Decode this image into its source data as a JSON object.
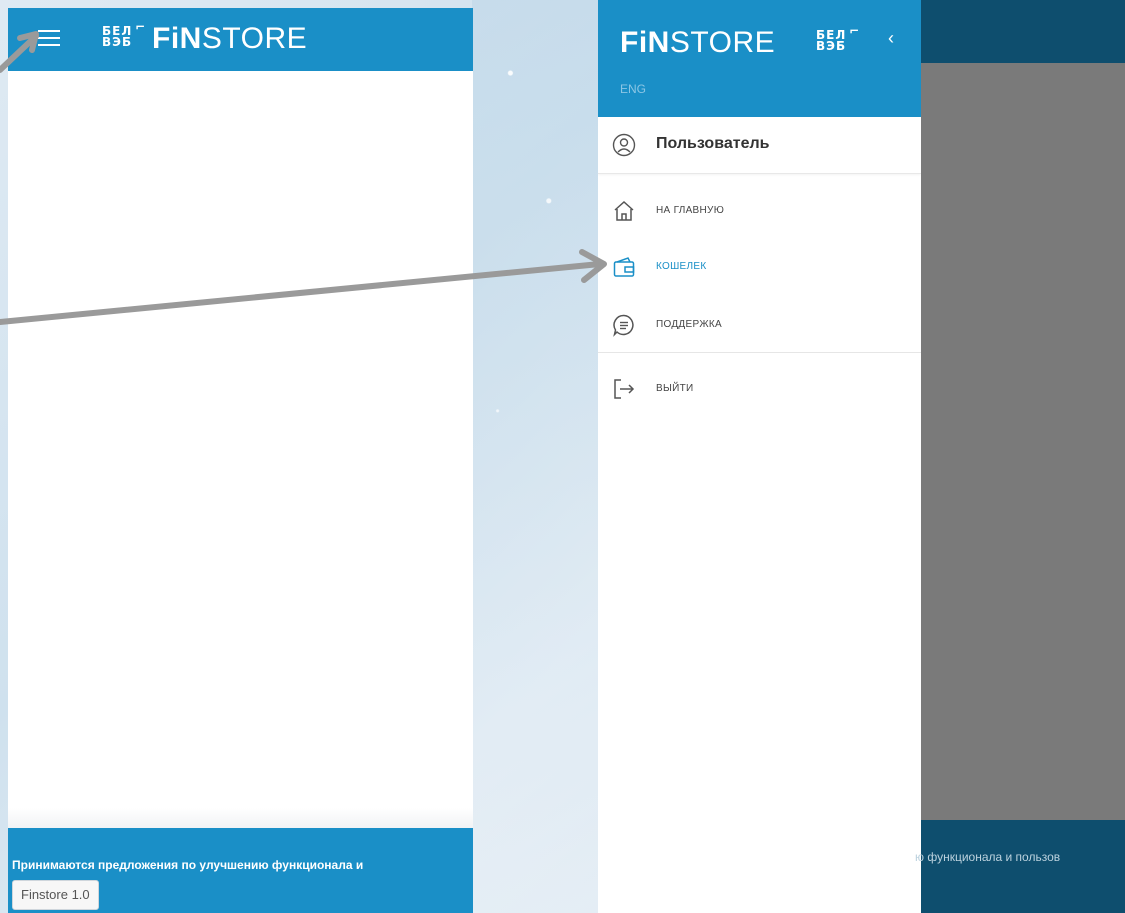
{
  "brand": {
    "bel_top": "БЕЛ",
    "bel_bottom": "ВЭБ",
    "fin_bold": "FiN",
    "fin_light": "STORE"
  },
  "left_screen": {
    "footer_text": "Принимаются предложения по улучшению функционала и",
    "version_label": "Finstore 1.0"
  },
  "drawer": {
    "back_icon": "chevron-left-icon",
    "lang_label": "ENG",
    "user_label": "Пользователь",
    "menu": [
      {
        "label": "НА ГЛАВНУЮ",
        "icon": "home-icon",
        "active": false
      },
      {
        "label": "КОШЕЛЕК",
        "icon": "wallet-icon",
        "active": true
      },
      {
        "label": "ПОДДЕРЖКА",
        "icon": "chat-icon",
        "active": false
      },
      {
        "label": "ВЫЙТИ",
        "icon": "logout-icon",
        "active": false
      }
    ]
  },
  "overlay": {
    "footer_text": "ю функционала и пользов"
  },
  "colors": {
    "brand_blue": "#1a8fc7",
    "dark_overlay": "#0e4e6e",
    "active_menu": "#1a8fc7",
    "arrow": "#9a9a9a"
  }
}
